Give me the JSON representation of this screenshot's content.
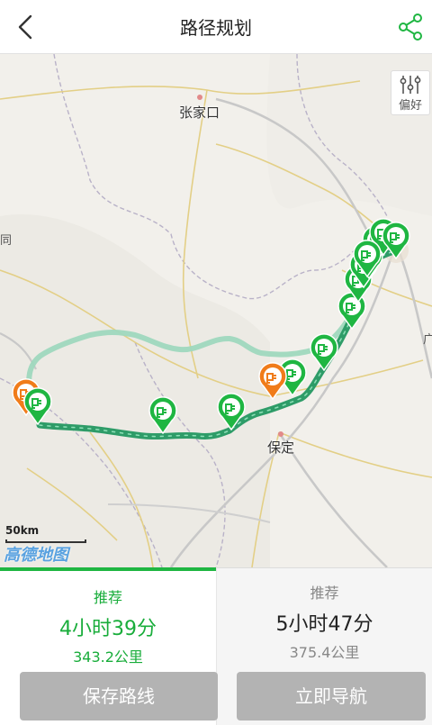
{
  "header": {
    "title": "路径规划",
    "back_icon": "chevron-left-icon",
    "share_icon": "share-icon"
  },
  "map": {
    "preference_label": "偏好",
    "preference_icon": "sliders-icon",
    "scale_label": "50km",
    "logo_text": "高德地图",
    "cities": [
      {
        "name": "张家口"
      },
      {
        "name": "保定"
      }
    ],
    "edge_labels": [
      "同",
      "广"
    ],
    "colors": {
      "selected_route": "#2e9c68",
      "alternate_route": "#9fd8be",
      "charger": "#1fb642",
      "endpoint": "#f07c1a"
    }
  },
  "routes": [
    {
      "tag": "推荐",
      "time": "4小时39分",
      "distance": "343.2公里",
      "selected": true
    },
    {
      "tag": "推荐",
      "time": "5小时47分",
      "distance": "375.4公里",
      "selected": false
    }
  ],
  "actions": {
    "save_label": "保存路线",
    "navigate_label": "立即导航"
  }
}
